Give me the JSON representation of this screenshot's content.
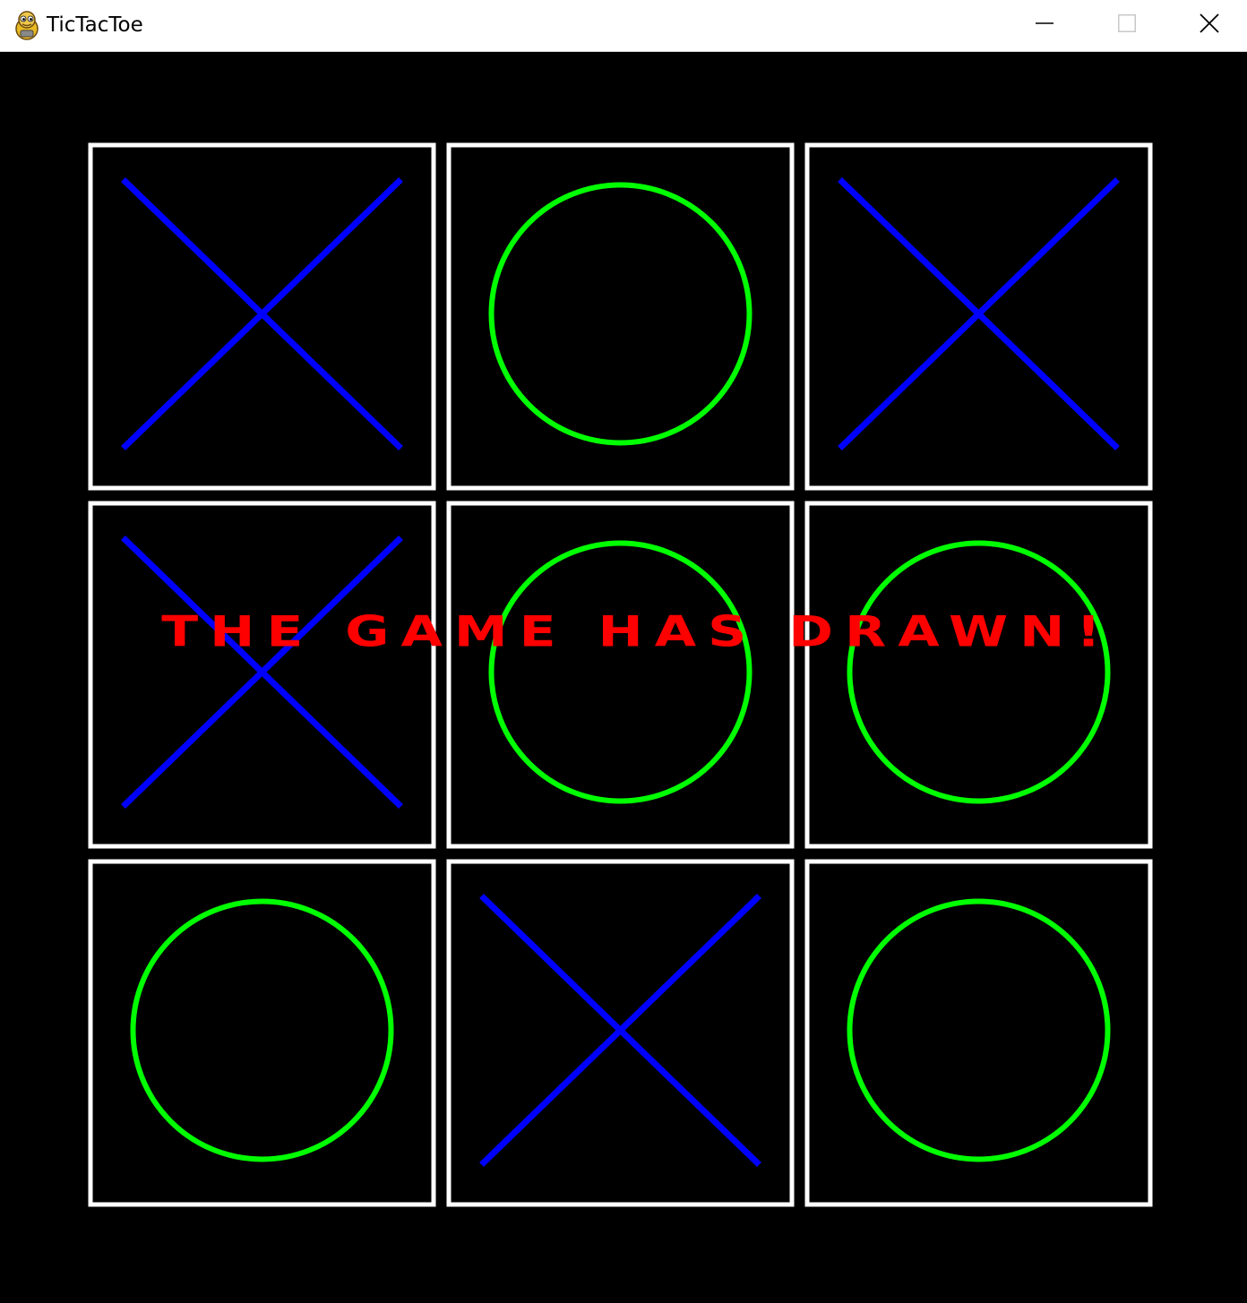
{
  "window": {
    "title": "TicTacToe",
    "app_icon": "pygame-snake-icon",
    "controls": {
      "minimize_icon": "minimize-icon",
      "maximize_icon": "maximize-icon",
      "close_icon": "close-icon"
    }
  },
  "game": {
    "board": [
      [
        "X",
        "O",
        "X"
      ],
      [
        "X",
        "O",
        "O"
      ],
      [
        "O",
        "X",
        "O"
      ]
    ],
    "status_text": "THE GAME HAS DRAWN!"
  },
  "colors": {
    "background": "#000000",
    "cell_border": "#ffffff",
    "x_mark": "#0000ff",
    "o_mark": "#00ff00",
    "status_text": "#ff0000"
  }
}
